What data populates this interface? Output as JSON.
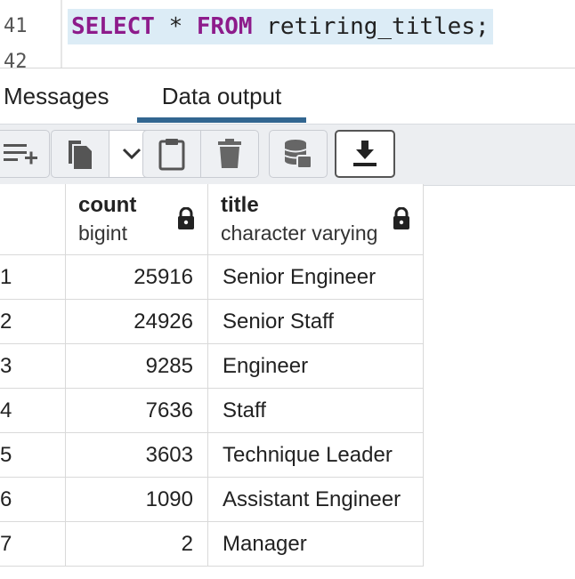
{
  "editor": {
    "line_numbers": [
      "41",
      "42"
    ],
    "query_keyword_select": "SELECT",
    "query_star": " * ",
    "query_keyword_from": "FROM",
    "query_rest": " retiring_titles;"
  },
  "tabs": [
    {
      "label": "Messages"
    },
    {
      "label": "Data output"
    }
  ],
  "toolbar": {
    "icons": [
      "add-row-icon",
      "copy-icon",
      "dropdown-chevron-icon",
      "paste-icon",
      "delete-icon",
      "save-data-icon",
      "download-icon"
    ]
  },
  "grid": {
    "columns": [
      {
        "name": "count",
        "type": "bigint"
      },
      {
        "name": "title",
        "type": "character varying"
      }
    ],
    "rows": [
      {
        "n": "1",
        "count": "25916",
        "title": "Senior Engineer"
      },
      {
        "n": "2",
        "count": "24926",
        "title": "Senior Staff"
      },
      {
        "n": "3",
        "count": "9285",
        "title": "Engineer"
      },
      {
        "n": "4",
        "count": "7636",
        "title": "Staff"
      },
      {
        "n": "5",
        "count": "3603",
        "title": "Technique Leader"
      },
      {
        "n": "6",
        "count": "1090",
        "title": "Assistant Engineer"
      },
      {
        "n": "7",
        "count": "2",
        "title": "Manager"
      }
    ]
  },
  "colors": {
    "accent": "#326690",
    "keyword": "#8d1b8b",
    "selection": "#dcecf6"
  }
}
